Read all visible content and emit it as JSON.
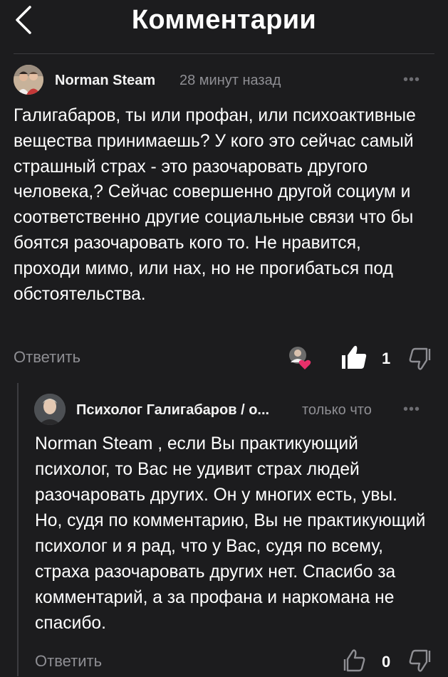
{
  "header": {
    "title": "Комментарии"
  },
  "comment": {
    "author": "Norman Steam",
    "time": "28 минут назад",
    "text": "Галигабаров, ты или профан, или психоактивные вещества принимаешь?  У кого это сейчас самый страшный страх - это разочаровать другого человека,? Сейчас совершенно другой социум и соответственно другие социальные связи что бы боятся разочаровать кого то. Не нравится, проходи мимо, или нах, но не прогибаться под  обстоятельства.",
    "reply_label": "Ответить",
    "likes": "1"
  },
  "reply": {
    "author": "Психолог Галигабаров / о...",
    "time": "только что",
    "text": "Norman Steam , если Вы практикующий психолог, то Вас не удивит страх людей разочаровать других. Он у многих есть, увы. Но, судя по комментарию, Вы не практикующий психолог и я рад, что у Вас, судя по всему, страха разочаровать других нет. Спасибо за комментарий, а за профана и наркомана не спасибо.",
    "reply_label": "Ответить",
    "likes": "0"
  },
  "icons": {
    "back": "chevron-left-icon",
    "more": "more-dots-icon",
    "like": "thumbs-up-icon",
    "dislike": "thumbs-down-icon",
    "author_liked": "author-avatar-heart-icon"
  },
  "colors": {
    "background": "#1c1c1e",
    "text": "#ffffff",
    "muted": "#8e8e93",
    "heart": "#e8306a"
  }
}
